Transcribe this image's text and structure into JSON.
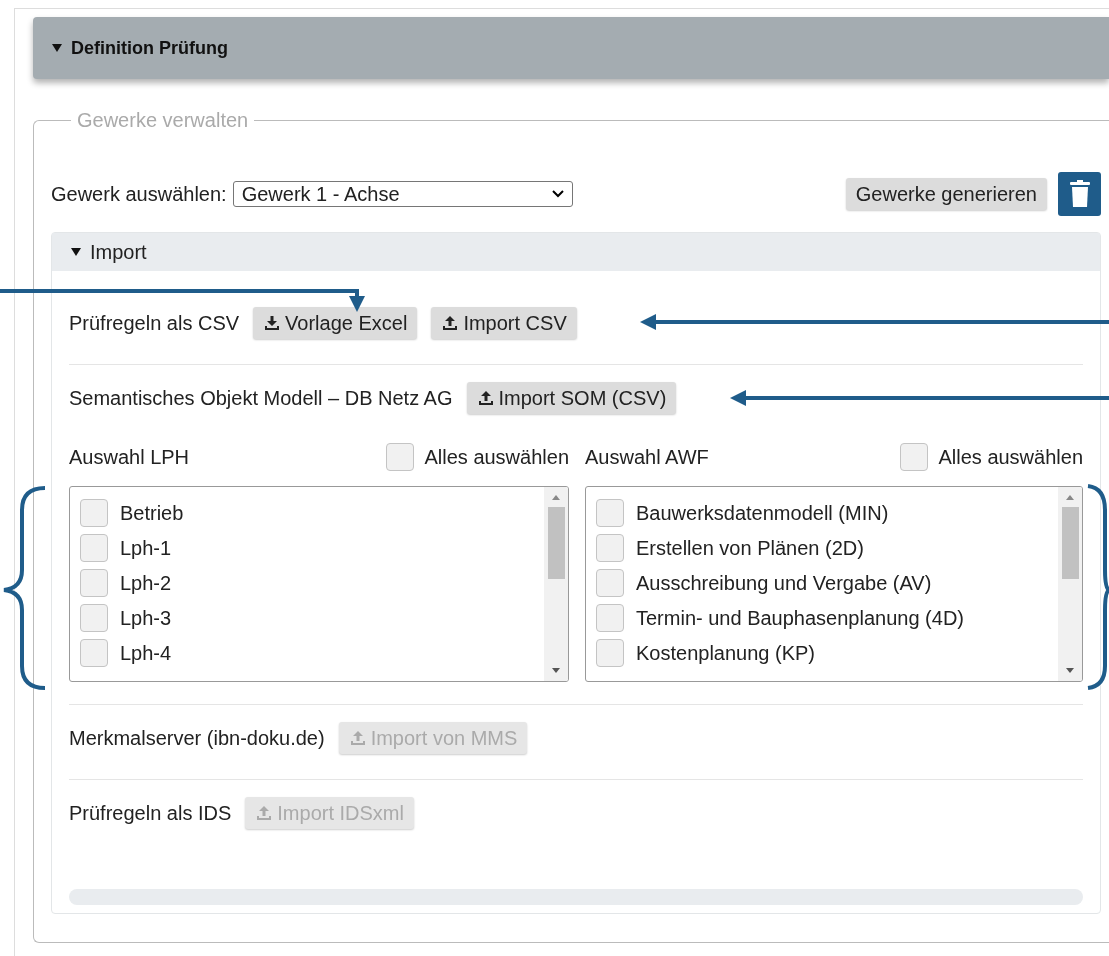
{
  "header": {
    "title": "Definition Prüfung",
    "expanded": true
  },
  "fieldset": {
    "legend": "Gewerke verwalten"
  },
  "gewerk": {
    "label": "Gewerk auswählen:",
    "value": "Gewerk 1 - Achse",
    "generate_button": "Gewerke generieren"
  },
  "import": {
    "title": "Import",
    "expanded": true,
    "rows": [
      {
        "kind": "buttons",
        "label": "Prüfregeln als CSV",
        "buttons": [
          {
            "label": "Vorlage Excel",
            "disabled": false
          },
          {
            "label": "Import CSV",
            "disabled": false
          }
        ]
      },
      {
        "kind": "buttons",
        "label": "Semantisches Objekt Modell – DB Netz AG",
        "buttons": [
          {
            "label": "Import SOM (CSV)",
            "disabled": false
          }
        ]
      },
      {
        "kind": "lists",
        "lists": [
          {
            "title": "Auswahl LPH",
            "select_all": {
              "label": "Alles auswählen",
              "checked": false
            },
            "items": [
              {
                "label": "Betrieb",
                "checked": false
              },
              {
                "label": "Lph-1",
                "checked": false
              },
              {
                "label": "Lph-2",
                "checked": false
              },
              {
                "label": "Lph-3",
                "checked": false
              },
              {
                "label": "Lph-4",
                "checked": false
              }
            ]
          },
          {
            "title": "Auswahl AWF",
            "select_all": {
              "label": "Alles auswählen",
              "checked": false
            },
            "items": [
              {
                "label": "Bauwerksdatenmodell (MIN)",
                "checked": false
              },
              {
                "label": "Erstellen von Plänen (2D)",
                "checked": false
              },
              {
                "label": "Ausschreibung und Vergabe (AV)",
                "checked": false
              },
              {
                "label": "Termin- und Bauphasenplanung (4D)",
                "checked": false
              },
              {
                "label": "Kostenplanung (KP)",
                "checked": false
              }
            ]
          }
        ]
      },
      {
        "kind": "buttons",
        "label": "Merkmalserver (ibn-doku.de)",
        "buttons": [
          {
            "label": "Import von MMS",
            "disabled": true
          }
        ]
      },
      {
        "kind": "buttons",
        "label": "Prüfregeln als IDS",
        "buttons": [
          {
            "label": "Import IDSxml",
            "disabled": true
          }
        ]
      },
      {
        "kind": "progress",
        "level": 0
      }
    ]
  }
}
